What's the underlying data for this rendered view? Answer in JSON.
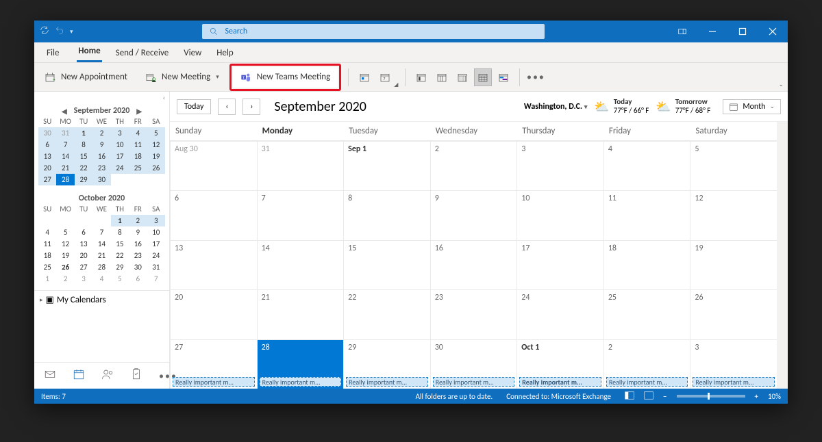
{
  "titlebar": {
    "search_placeholder": "Search"
  },
  "ribbon": {
    "tabs": {
      "file": "File",
      "home": "Home",
      "send": "Send / Receive",
      "view": "View",
      "help": "Help"
    },
    "new_appointment": "New Appointment",
    "new_meeting": "New Meeting",
    "new_teams_meeting": "New Teams Meeting"
  },
  "sidebar": {
    "month1": "September 2020",
    "month2": "October 2020",
    "dows": [
      "SU",
      "MO",
      "TU",
      "WE",
      "TH",
      "FR",
      "SA"
    ],
    "sept_rows": [
      [
        {
          "d": "30",
          "muted": true,
          "shade": true
        },
        {
          "d": "31",
          "muted": true,
          "shade": true
        },
        {
          "d": "1",
          "bold": true,
          "shade": true
        },
        {
          "d": "2",
          "shade": true
        },
        {
          "d": "3",
          "shade": true
        },
        {
          "d": "4",
          "shade": true
        },
        {
          "d": "5",
          "shade": true
        }
      ],
      [
        {
          "d": "6",
          "shade": true
        },
        {
          "d": "7",
          "shade": true
        },
        {
          "d": "8",
          "shade": true
        },
        {
          "d": "9",
          "shade": true
        },
        {
          "d": "10",
          "shade": true
        },
        {
          "d": "11",
          "shade": true
        },
        {
          "d": "12",
          "shade": true
        }
      ],
      [
        {
          "d": "13",
          "shade": true
        },
        {
          "d": "14",
          "shade": true
        },
        {
          "d": "15",
          "shade": true
        },
        {
          "d": "16",
          "shade": true
        },
        {
          "d": "17",
          "shade": true
        },
        {
          "d": "18",
          "shade": true
        },
        {
          "d": "19",
          "shade": true
        }
      ],
      [
        {
          "d": "20",
          "shade": true
        },
        {
          "d": "21",
          "shade": true
        },
        {
          "d": "22",
          "shade": true
        },
        {
          "d": "23",
          "shade": true
        },
        {
          "d": "24",
          "shade": true
        },
        {
          "d": "25",
          "shade": true
        },
        {
          "d": "26",
          "shade": true
        }
      ],
      [
        {
          "d": "27",
          "shade": true
        },
        {
          "d": "28",
          "today": true
        },
        {
          "d": "29",
          "shade": true
        },
        {
          "d": "30",
          "shade": true
        },
        {
          "d": ""
        },
        {
          "d": ""
        },
        {
          "d": ""
        }
      ]
    ],
    "oct_rows": [
      [
        {
          "d": ""
        },
        {
          "d": ""
        },
        {
          "d": ""
        },
        {
          "d": ""
        },
        {
          "d": "1",
          "bold": true,
          "shade": true
        },
        {
          "d": "2",
          "shade": true
        },
        {
          "d": "3",
          "shade": true
        }
      ],
      [
        {
          "d": "4"
        },
        {
          "d": "5"
        },
        {
          "d": "6"
        },
        {
          "d": "7"
        },
        {
          "d": "8"
        },
        {
          "d": "9"
        },
        {
          "d": "10"
        }
      ],
      [
        {
          "d": "11"
        },
        {
          "d": "12"
        },
        {
          "d": "13"
        },
        {
          "d": "14"
        },
        {
          "d": "15"
        },
        {
          "d": "16"
        },
        {
          "d": "17"
        }
      ],
      [
        {
          "d": "18"
        },
        {
          "d": "19"
        },
        {
          "d": "20"
        },
        {
          "d": "21"
        },
        {
          "d": "22"
        },
        {
          "d": "23"
        },
        {
          "d": "24"
        }
      ],
      [
        {
          "d": "25"
        },
        {
          "d": "26",
          "bold": true
        },
        {
          "d": "27"
        },
        {
          "d": "28"
        },
        {
          "d": "29"
        },
        {
          "d": "30"
        },
        {
          "d": "31"
        }
      ],
      [
        {
          "d": "1",
          "muted": true
        },
        {
          "d": "2",
          "muted": true
        },
        {
          "d": "3",
          "muted": true
        },
        {
          "d": "4",
          "muted": true
        },
        {
          "d": "5",
          "muted": true
        },
        {
          "d": "6",
          "muted": true
        },
        {
          "d": "7",
          "muted": true
        }
      ]
    ],
    "my_calendars": "My Calendars"
  },
  "calendar": {
    "today_btn": "Today",
    "title": "September 2020",
    "location": "Washington, D.C.",
    "weather_today": {
      "label": "Today",
      "temps": "77°F / 66° F"
    },
    "weather_tomorrow": {
      "label": "Tomorrow",
      "temps": "77°F / 68° F"
    },
    "view": "Month",
    "dows": [
      "Sunday",
      "Monday",
      "Tuesday",
      "Wednesday",
      "Thursday",
      "Friday",
      "Saturday"
    ],
    "dow_bold_index": 1,
    "weeks": [
      [
        {
          "l": "Aug 30",
          "muted": true
        },
        {
          "l": "31",
          "muted": true
        },
        {
          "l": "Sep 1",
          "bold": true
        },
        {
          "l": "2"
        },
        {
          "l": "3"
        },
        {
          "l": "4"
        },
        {
          "l": "5"
        }
      ],
      [
        {
          "l": "6"
        },
        {
          "l": "7"
        },
        {
          "l": "8"
        },
        {
          "l": "9"
        },
        {
          "l": "10"
        },
        {
          "l": "11"
        },
        {
          "l": "12"
        }
      ],
      [
        {
          "l": "13"
        },
        {
          "l": "14"
        },
        {
          "l": "15"
        },
        {
          "l": "16"
        },
        {
          "l": "17"
        },
        {
          "l": "18"
        },
        {
          "l": "19"
        }
      ],
      [
        {
          "l": "20"
        },
        {
          "l": "21"
        },
        {
          "l": "22"
        },
        {
          "l": "23"
        },
        {
          "l": "24"
        },
        {
          "l": "25"
        },
        {
          "l": "26"
        }
      ],
      [
        {
          "l": "27",
          "ev": true
        },
        {
          "l": "28",
          "today": true,
          "ev": true
        },
        {
          "l": "29",
          "ev": true
        },
        {
          "l": "30",
          "ev": true
        },
        {
          "l": "Oct 1",
          "bold": true,
          "ev": true
        },
        {
          "l": "2",
          "ev": true
        },
        {
          "l": "3",
          "ev": true
        }
      ]
    ],
    "event_label": "Really important m..."
  },
  "status": {
    "items": "Items: 7",
    "sync": "All folders are up to date.",
    "conn": "Connected to: Microsoft Exchange",
    "zoom": "10%"
  }
}
